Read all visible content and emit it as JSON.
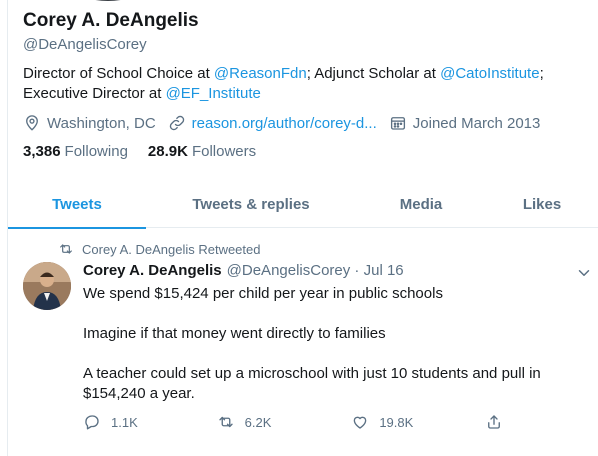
{
  "profile": {
    "name": "Corey A. DeAngelis",
    "handle": "@DeAngelisCorey",
    "bio": {
      "t1": "Director of School Choice at ",
      "m1": "@ReasonFdn",
      "t2": "; Adjunct Scholar at ",
      "m2": "@CatoInstitute",
      "t3": ";",
      "t4": "Executive Director at ",
      "m3": "@EF_Institute"
    },
    "location": "Washington, DC",
    "website": "reason.org/author/corey-d...",
    "joined": "Joined March 2013",
    "following_count": "3,386",
    "following_label": "Following",
    "followers_count": "28.9K",
    "followers_label": "Followers"
  },
  "tabs": [
    {
      "label": "Tweets",
      "active": true
    },
    {
      "label": "Tweets & replies"
    },
    {
      "label": "Media"
    },
    {
      "label": "Likes"
    }
  ],
  "tweet": {
    "retweet_label": "Corey A. DeAngelis Retweeted",
    "author_name": "Corey A. DeAngelis",
    "author_handle": "@DeAngelisCorey · Jul 16",
    "lines": [
      "We spend $15,424 per child per year in public schools",
      "Imagine if that money went directly to families",
      "A teacher could set up a microschool with just 10 students and pull in $154,240 a year."
    ],
    "replies": "1.1K",
    "retweets": "6.2K",
    "likes": "19.8K"
  },
  "colors": {
    "accent": "#1b95e0",
    "secondary_text": "#5b7083",
    "primary_text": "#14171a",
    "divider": "#e6ecf0"
  },
  "icons": [
    "location-icon",
    "link-icon",
    "calendar-icon",
    "retweet-icon",
    "chevron-down-icon",
    "reply-icon",
    "like-icon",
    "share-icon"
  ]
}
